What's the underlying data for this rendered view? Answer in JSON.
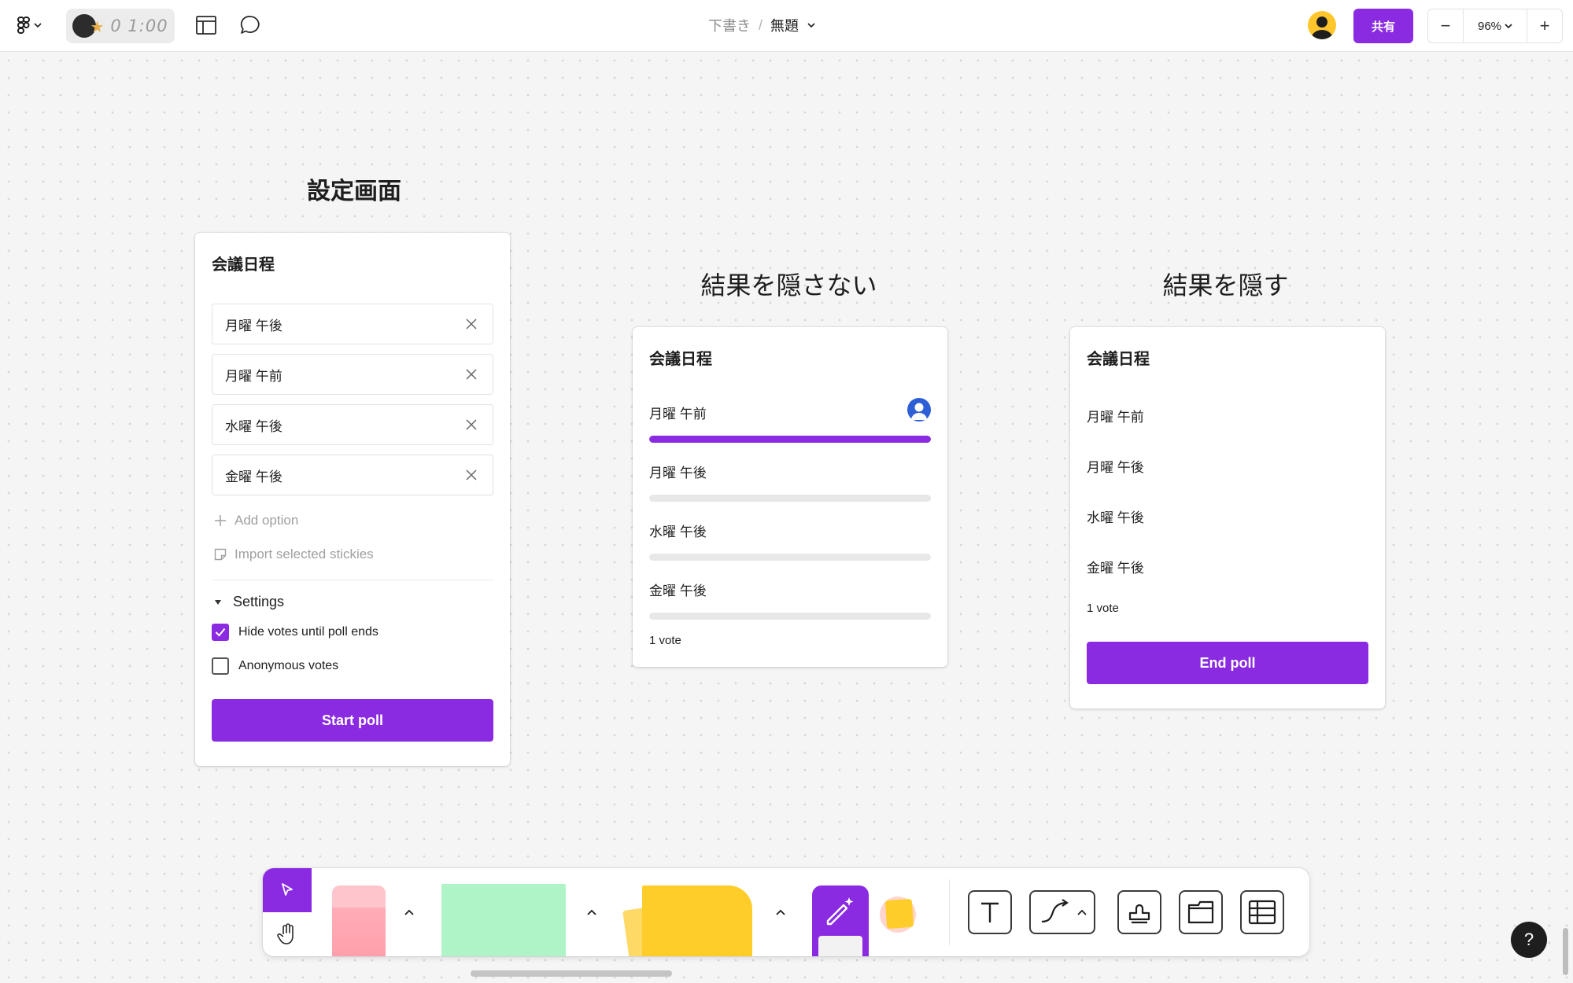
{
  "topbar": {
    "timer": "0 1:00",
    "breadcrumb_draft": "下書き",
    "breadcrumb_separator": "/",
    "file_title": "無題",
    "share_label": "共有",
    "zoom_out": "−",
    "zoom_level": "96%",
    "zoom_in": "+"
  },
  "headings": {
    "settings": "設定画面",
    "results_visible": "結果を隠さない",
    "results_hidden": "結果を隠す"
  },
  "poll_setup": {
    "title": "会議日程",
    "options": [
      "月曜 午後",
      "月曜 午前",
      "水曜 午後",
      "金曜 午後"
    ],
    "add_option": "Add option",
    "import_stickies": "Import selected stickies",
    "settings_label": "Settings",
    "hide_votes_label": "Hide votes until poll ends",
    "hide_votes_checked": true,
    "anonymous_label": "Anonymous votes",
    "anonymous_checked": false,
    "start_button": "Start poll"
  },
  "poll_results_visible": {
    "title": "会議日程",
    "rows": [
      {
        "label": "月曜 午前",
        "fraction": 1.0,
        "has_voter": true
      },
      {
        "label": "月曜 午後",
        "fraction": 0,
        "has_voter": false
      },
      {
        "label": "水曜 午後",
        "fraction": 0,
        "has_voter": false
      },
      {
        "label": "金曜 午後",
        "fraction": 0,
        "has_voter": false
      }
    ],
    "vote_count": "1 vote"
  },
  "poll_results_hidden": {
    "title": "会議日程",
    "options": [
      "月曜 午前",
      "月曜 午後",
      "水曜 午後",
      "金曜 午後"
    ],
    "vote_count": "1 vote",
    "end_button": "End poll"
  },
  "help": {
    "label": "?"
  },
  "colors": {
    "accent": "#8a2be2",
    "bar_track": "#e8e8e8",
    "voter_avatar": "#2f5fd6"
  }
}
